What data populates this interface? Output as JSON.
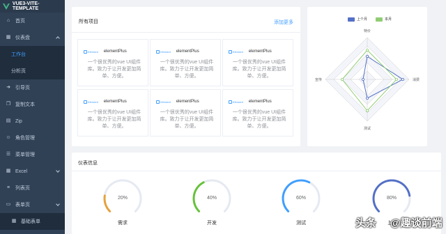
{
  "app": {
    "title": "VUE3-VITE-TEMPLATE"
  },
  "sidebar": {
    "items": [
      {
        "label": "首页",
        "icon": "home-icon"
      },
      {
        "label": "仪表盘",
        "icon": "dashboard-icon",
        "expanded": true,
        "children": [
          {
            "label": "工作台",
            "active": true
          },
          {
            "label": "分析页"
          }
        ]
      },
      {
        "label": "引导页",
        "icon": "guide-icon"
      },
      {
        "label": "复制文本",
        "icon": "copy-icon"
      },
      {
        "label": "Zip",
        "icon": "zip-icon"
      },
      {
        "label": "角色管理",
        "icon": "role-icon"
      },
      {
        "label": "菜单管理",
        "icon": "menu-icon"
      },
      {
        "label": "Excel",
        "icon": "excel-icon"
      },
      {
        "label": "列表页",
        "icon": "list-icon"
      },
      {
        "label": "表单页",
        "icon": "form-icon"
      },
      {
        "label": "基础表单",
        "icon": "grid-icon"
      }
    ]
  },
  "projects": {
    "title": "所有项目",
    "more": "添加更多",
    "items": [
      {
        "brand": "Element",
        "name": "elementPlus",
        "desc": "一个很优秀的vue UI组件库。致力于让开发更加简单、方便。"
      },
      {
        "brand": "Element",
        "name": "elementPlus",
        "desc": "一个很优秀的vue UI组件库。致力于让开发更加简单、方便。"
      },
      {
        "brand": "Element",
        "name": "elementPlus",
        "desc": "一个很优秀的vue UI组件库。致力于让开发更加简单、方便。"
      },
      {
        "brand": "Element",
        "name": "elementPlus",
        "desc": "一个很优秀的vue UI组件库。致力于让开发更加简单、方便。"
      },
      {
        "brand": "Element",
        "name": "elementPlus",
        "desc": "一个很优秀的vue UI组件库。致力于让开发更加简单、方便。"
      },
      {
        "brand": "Element",
        "name": "elementPlus",
        "desc": "一个很优秀的vue UI组件库。致力于让开发更加简单、方便。"
      }
    ]
  },
  "chart_data": [
    {
      "type": "radar",
      "indicators": [
        "特价",
        "消费",
        "测试",
        "宣传"
      ],
      "series": [
        {
          "name": "上个月",
          "color": "#5470c6",
          "values": [
            0.55,
            0.85,
            0.45,
            0.1
          ]
        },
        {
          "name": "本月",
          "color": "#91cc75",
          "values": [
            0.7,
            0.7,
            0.75,
            0.6
          ]
        }
      ],
      "legend": "top"
    },
    {
      "type": "gauge",
      "title": "仪表信息",
      "items": [
        {
          "label": "需求",
          "value": "20%",
          "fraction": 0.2,
          "color": "#e6a23c"
        },
        {
          "label": "开发",
          "value": "40%",
          "fraction": 0.4,
          "color": "#67c23a"
        },
        {
          "label": "测试",
          "value": "60%",
          "fraction": 0.6,
          "color": "#409eff"
        },
        {
          "label": "上线",
          "value": "80%",
          "fraction": 0.8,
          "color": "#5470c6"
        }
      ]
    }
  ],
  "watermark": {
    "text1": "头条",
    "text2": "@趣谈前端"
  }
}
